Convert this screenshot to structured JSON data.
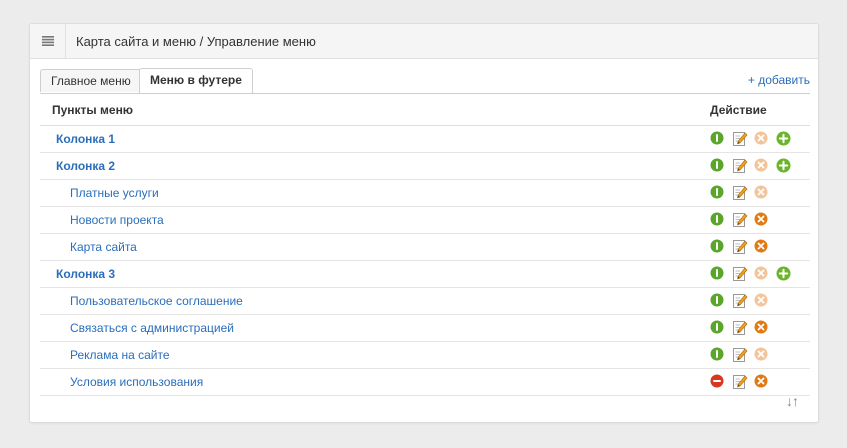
{
  "header": {
    "title": "Карта сайта и меню / Управление меню",
    "menu_icon": "hamburger-icon"
  },
  "tabs": [
    {
      "label": "Главное меню",
      "active": false
    },
    {
      "label": "Меню в футере",
      "active": true
    }
  ],
  "add_link": "+ добавить",
  "table": {
    "columns": [
      "Пункты меню",
      "Действие"
    ],
    "rows": [
      {
        "label": "Колонка 1",
        "level": 0,
        "status": "on",
        "delete": "disabled",
        "add": true
      },
      {
        "label": "Колонка 2",
        "level": 0,
        "status": "on",
        "delete": "disabled",
        "add": true
      },
      {
        "label": "Платные услуги",
        "level": 1,
        "status": "on",
        "delete": "disabled",
        "add": false
      },
      {
        "label": "Новости проекта",
        "level": 1,
        "status": "on",
        "delete": "enabled",
        "add": false
      },
      {
        "label": "Карта сайта",
        "level": 1,
        "status": "on",
        "delete": "enabled",
        "add": false
      },
      {
        "label": "Колонка 3",
        "level": 0,
        "status": "on",
        "delete": "disabled",
        "add": true
      },
      {
        "label": "Пользовательское соглашение",
        "level": 1,
        "status": "on",
        "delete": "disabled",
        "add": false
      },
      {
        "label": "Связаться с администрацией",
        "level": 1,
        "status": "on",
        "delete": "enabled",
        "add": false
      },
      {
        "label": "Реклама на сайте",
        "level": 1,
        "status": "on",
        "delete": "disabled",
        "add": false
      },
      {
        "label": "Условия использования",
        "level": 1,
        "status": "off",
        "delete": "enabled",
        "add": false
      }
    ]
  },
  "sort_icon": "↓↑",
  "colors": {
    "link": "#2a6ebb",
    "status_on": "#5aa62a",
    "status_off": "#d9381e",
    "delete_enabled": "#e07a12",
    "delete_disabled": "#f3c49a",
    "add": "#6bb52b"
  }
}
